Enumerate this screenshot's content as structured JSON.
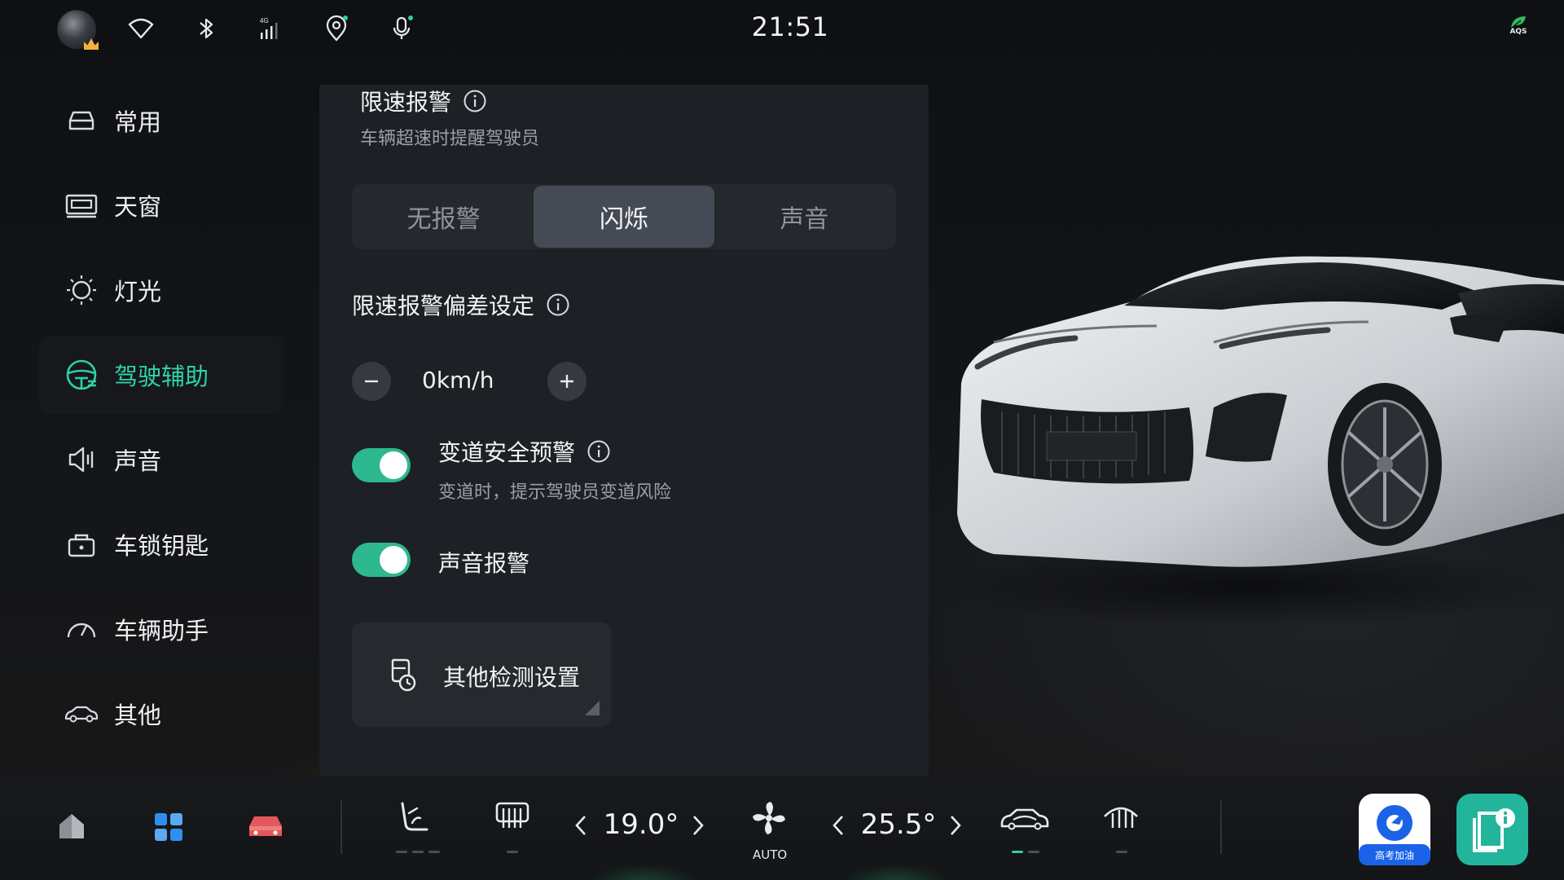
{
  "status_bar": {
    "time": "21:51",
    "aqs_label": "AQS",
    "icons": [
      "avatar",
      "wifi-icon",
      "bluetooth-icon",
      "signal-4g-icon",
      "location-icon",
      "microphone-icon",
      "aqs-leaf-icon"
    ],
    "network_label": "4G"
  },
  "sidebar": {
    "items": [
      {
        "label": "常用",
        "icon": "car-front-icon",
        "active": false
      },
      {
        "label": "天窗",
        "icon": "sunroof-icon",
        "active": false
      },
      {
        "label": "灯光",
        "icon": "light-icon",
        "active": false
      },
      {
        "label": "驾驶辅助",
        "icon": "steering-wheel-icon",
        "active": true
      },
      {
        "label": "声音",
        "icon": "speaker-icon",
        "active": false
      },
      {
        "label": "车锁钥匙",
        "icon": "lock-key-icon",
        "active": false
      },
      {
        "label": "车辆助手",
        "icon": "gauge-icon",
        "active": false
      },
      {
        "label": "其他",
        "icon": "car-side-icon",
        "active": false
      }
    ]
  },
  "panel": {
    "speed_alert": {
      "title": "限速报警",
      "subtitle": "车辆超速时提醒驾驶员",
      "options": [
        "无报警",
        "闪烁",
        "声音"
      ],
      "selected": "闪烁"
    },
    "deviation": {
      "title": "限速报警偏差设定",
      "value": "0km/h"
    },
    "lane_change": {
      "title": "变道安全预警",
      "subtitle": "变道时，提示驾驶员变道风险",
      "enabled": true
    },
    "sound_alert": {
      "title": "声音报警",
      "enabled": true
    },
    "other_card": {
      "label": "其他检测设置"
    }
  },
  "dock": {
    "left_temp": "19.0°",
    "right_temp": "25.5°",
    "fan_label": "AUTO",
    "app1_label": "高考加油",
    "colors": {
      "accent": "#2fd1a6",
      "car_app": "#e2595b",
      "apps_blue": "#2f8ff0"
    }
  }
}
